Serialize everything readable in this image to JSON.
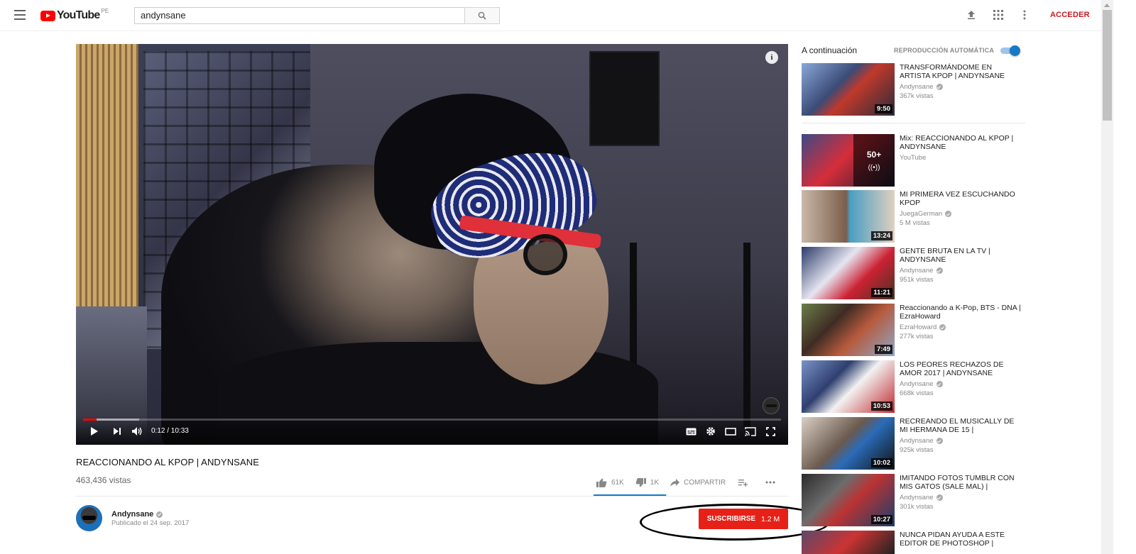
{
  "header": {
    "logo_text": "YouTube",
    "logo_region": "PE",
    "search_value": "andynsane",
    "signin_label": "ACCEDER"
  },
  "player": {
    "time_current": "0:12",
    "time_total": "10:33",
    "time_display": "0:12 / 10:33",
    "progress_fraction": 0.019,
    "buffered_fraction": 0.08,
    "info_glyph": "i"
  },
  "video": {
    "title": "REACCIONANDO AL KPOP | ANDYNSANE",
    "views": "463,436 vistas",
    "likes": "61K",
    "dislikes": "1K",
    "share_label": "COMPARTIR",
    "like_ratio": 0.98
  },
  "channel": {
    "name": "Andynsane",
    "published": "Publicado el 24 sep. 2017",
    "subscribe_label": "SUSCRIBIRSE",
    "subscriber_count": "1.2 M"
  },
  "sidebar": {
    "up_next_label": "A continuación",
    "autoplay_label": "REPRODUCCIÓN AUTOMÁTICA",
    "autoplay_on": true,
    "items": [
      {
        "title": "TRANSFORMÁNDOME EN ARTISTA KPOP | ANDYNSANE",
        "channel": "Andynsane",
        "verified": true,
        "views": "367k vistas",
        "duration": "9:50"
      },
      {
        "title": "Mix: REACCIONANDO AL KPOP | ANDYNSANE",
        "channel": "YouTube",
        "verified": false,
        "views": "",
        "duration": "",
        "mix_count": "50+"
      },
      {
        "title": "MI PRIMERA VEZ ESCUCHANDO KPOP",
        "channel": "JuegaGerman",
        "verified": true,
        "views": "5 M vistas",
        "duration": "13:24"
      },
      {
        "title": "GENTE BRUTA EN LA TV | ANDYNSANE",
        "channel": "Andynsane",
        "verified": true,
        "views": "951k vistas",
        "duration": "11:21"
      },
      {
        "title": "Reaccionando a K-Pop, BTS - DNA | EzraHoward",
        "channel": "EzraHoward",
        "verified": true,
        "views": "277k vistas",
        "duration": "7:49"
      },
      {
        "title": "LOS PEORES RECHAZOS DE AMOR 2017 | ANDYNSANE",
        "channel": "Andynsane",
        "verified": true,
        "views": "668k vistas",
        "duration": "10:53"
      },
      {
        "title": "RECREANDO EL MUSICALLY DE MI HERMANA DE 15 |",
        "channel": "Andynsane",
        "verified": true,
        "views": "925k vistas",
        "duration": "10:02"
      },
      {
        "title": "IMITANDO FOTOS TUMBLR CON MIS GATOS (SALE MAL) |",
        "channel": "Andynsane",
        "verified": true,
        "views": "301k vistas",
        "duration": "10:27"
      },
      {
        "title": "NUNCA PIDAN AYUDA A ESTE EDITOR DE PHOTOSHOP |",
        "channel": "",
        "verified": false,
        "views": "",
        "duration": ""
      }
    ]
  },
  "colors": {
    "brand_red": "#ff0000",
    "subscribe_red": "#e62117",
    "signin_red": "#cc181e",
    "accent_blue": "#167ac6"
  },
  "icons": [
    "menu-icon",
    "search-icon",
    "upload-icon",
    "apps-icon",
    "more-vert-icon",
    "info-icon",
    "play-icon",
    "next-icon",
    "volume-icon",
    "subtitles-icon",
    "settings-icon",
    "theater-icon",
    "cast-icon",
    "fullscreen-icon",
    "thumb-up-icon",
    "thumb-down-icon",
    "share-icon",
    "add-to-playlist-icon",
    "more-horiz-icon",
    "verified-icon"
  ]
}
